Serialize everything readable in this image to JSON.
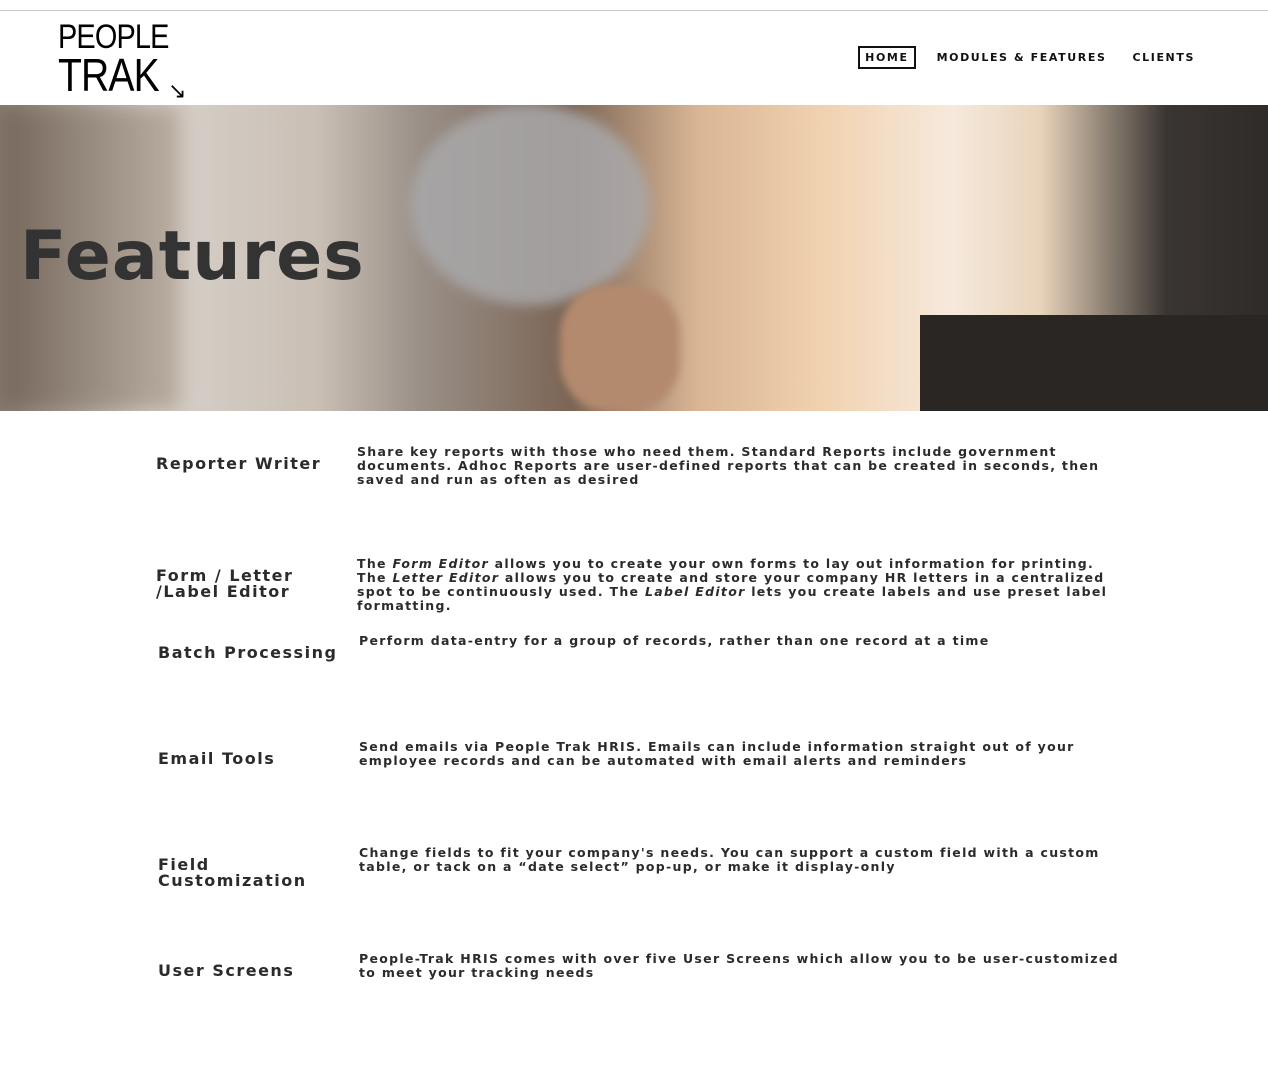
{
  "logo": {
    "line1": "PEOPLE",
    "line2": "TRAK",
    "arrow": "↘"
  },
  "nav": [
    {
      "label": "HOME",
      "active": true
    },
    {
      "label": "MODULES & FEATURES"
    },
    {
      "label": "CLIENTS"
    }
  ],
  "hero": {
    "title": "Features"
  },
  "features": [
    {
      "title": "Reporter Writer",
      "desc": "Share key reports with those who need them. Standard Reports include government documents. Adhoc Reports are user-defined reports that can be created in seconds, then saved and run as often as desired"
    },
    {
      "title": "Form / Letter /Label Editor",
      "desc_parts": [
        "The ",
        "Form Editor",
        " allows you to create your own forms to lay out information for printing. The ",
        "Letter Editor",
        " allows you to create and store your company HR letters in a centralized spot to be continuously used. The ",
        "Label Editor",
        " lets you create labels and use preset label formatting."
      ]
    },
    {
      "title": "Batch Processing",
      "desc": "Perform data-entry for a group of records, rather than one record at a time"
    },
    {
      "title": "Email Tools",
      "desc": "Send emails via People Trak HRIS. Emails can include information straight out of your employee records and can be automated with email alerts and reminders"
    },
    {
      "title": "Field Customization",
      "desc": "Change fields to fit your company's needs. You can support a custom field with a custom table, or tack on a “date select” pop-up, or make it display-only"
    },
    {
      "title": "User Screens",
      "desc": "People-Trak HRIS comes with over five User Screens which allow you to be user-customized to meet your tracking needs"
    }
  ]
}
